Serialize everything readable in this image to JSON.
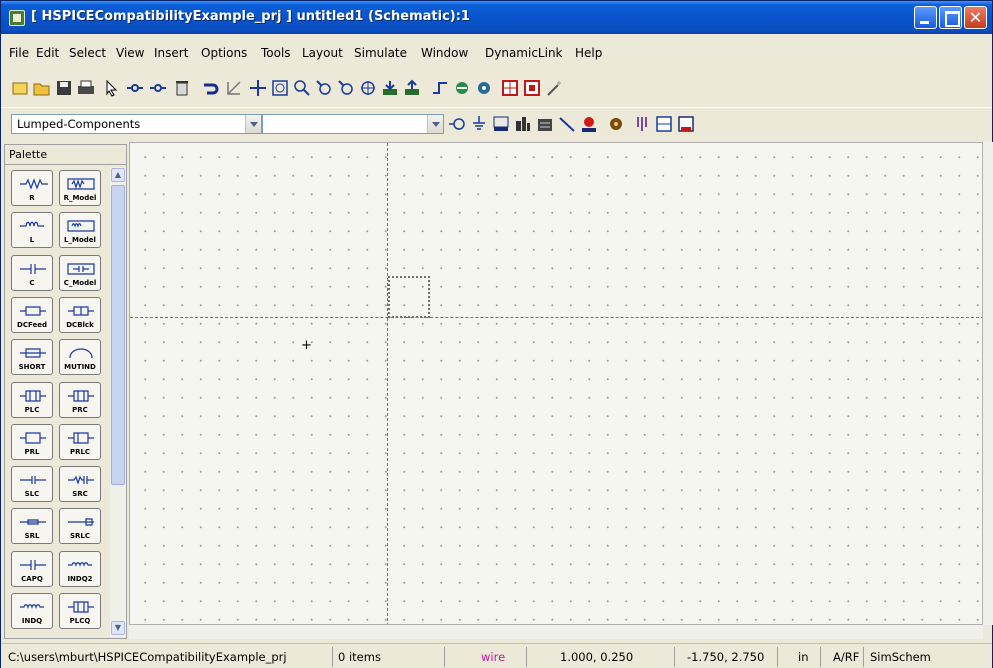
{
  "window": {
    "title": "[ HSPICECompatibilityExample_prj ] untitled1 (Schematic):1",
    "controls": [
      "minimize",
      "maximize",
      "close"
    ]
  },
  "menubar": [
    "File",
    "Edit",
    "Select",
    "View",
    "Insert",
    "Options",
    "Tools",
    "Layout",
    "Simulate",
    "Window",
    "DynamicLink",
    "Help"
  ],
  "toolbar1": {
    "icons": [
      "new-file-icon",
      "open-folder-icon",
      "save-icon",
      "print-icon",
      "select-arrow-icon",
      "insert-pin-icon",
      "insert-pin-group-icon",
      "delete-icon",
      "undo-icon",
      "rotate-icon",
      "move-icon",
      "zoom-box-icon",
      "zoom-in-icon",
      "zoom-out-icon",
      "zoom-fit-icon",
      "zoom-all-icon",
      "push-down-icon",
      "pop-up-icon",
      "wire-icon",
      "flip-icon",
      "rotate-component-icon",
      "grid-icon",
      "snap-icon",
      "magic-wand-icon"
    ]
  },
  "toolbar2": {
    "library_combo": "Lumped-Components",
    "component_combo": "",
    "icons": [
      "port-icon",
      "ground-icon",
      "var-icon",
      "vna-icon",
      "simulate-icon",
      "wire-line-icon",
      "name-icon",
      "tune-icon",
      "optimize-icon",
      "display-icon",
      "datasheet-icon"
    ]
  },
  "palette": {
    "title": "Palette",
    "items": [
      [
        "R",
        "R_Model"
      ],
      [
        "L",
        "L_Model"
      ],
      [
        "C",
        "C_Model"
      ],
      [
        "DCFeed",
        "DCBlck"
      ],
      [
        "SHORT",
        "MUTIND"
      ],
      [
        "PLC",
        "PRC"
      ],
      [
        "PRL",
        "PRLC"
      ],
      [
        "SLC",
        "SRC"
      ],
      [
        "SRL",
        "SRLC"
      ],
      [
        "CAPQ",
        "INDQ2"
      ],
      [
        "INDQ",
        "PLCQ"
      ]
    ]
  },
  "statusbar": {
    "path": "C:\\users\\mburt\\HSPICECompatibilityExample_prj",
    "items": "0 items",
    "mode": "wire",
    "coord1": "1.000, 0.250",
    "coord2": "-1.750, 2.750",
    "units": "in",
    "domain": "A/RF",
    "app": "SimSchem"
  },
  "colors": {
    "titlebar": "#0a53cc",
    "wire_text": "#c21d9b",
    "canvas": "#f6f6f1"
  }
}
